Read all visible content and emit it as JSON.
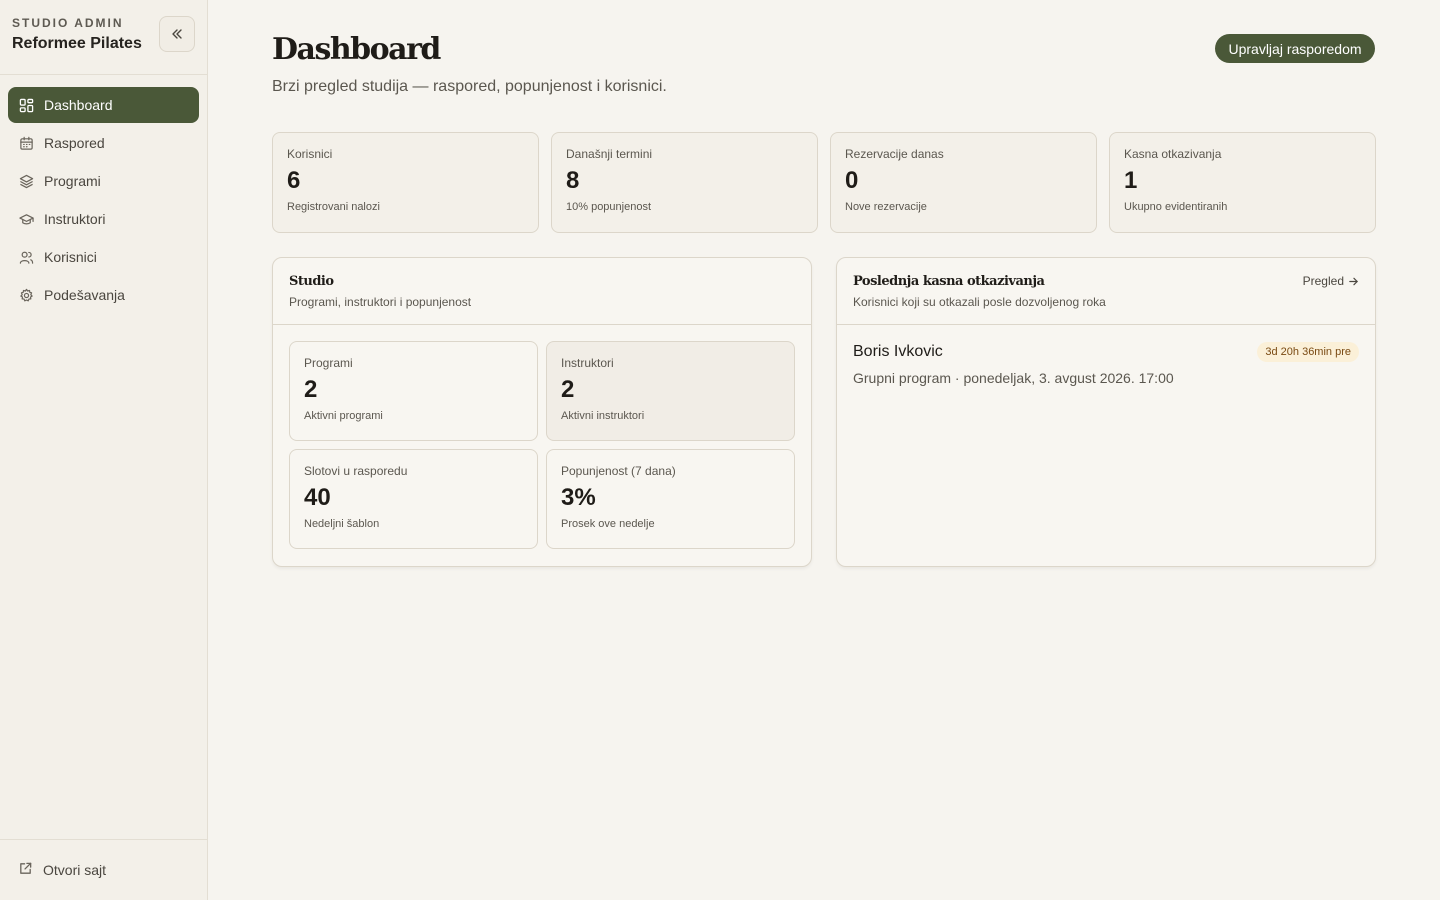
{
  "sidebar": {
    "eyebrow": "STUDIO ADMIN",
    "brand": "Reformee Pilates",
    "items": [
      {
        "label": "Dashboard",
        "icon": "dashboard-icon"
      },
      {
        "label": "Raspored",
        "icon": "calendar-icon"
      },
      {
        "label": "Programi",
        "icon": "layers-icon"
      },
      {
        "label": "Instruktori",
        "icon": "graduation-cap-icon"
      },
      {
        "label": "Korisnici",
        "icon": "users-icon"
      },
      {
        "label": "Podešavanja",
        "icon": "gear-icon"
      }
    ],
    "footer_link": "Otvori sajt"
  },
  "header": {
    "title": "Dashboard",
    "subtitle": "Brzi pregled studija — raspored, popunjenost i korisnici.",
    "action": "Upravljaj rasporedom"
  },
  "stats": [
    {
      "label": "Korisnici",
      "value": "6",
      "hint": "Registrovani nalozi"
    },
    {
      "label": "Današnji termini",
      "value": "8",
      "hint": "10% popunjenost"
    },
    {
      "label": "Rezervacije danas",
      "value": "0",
      "hint": "Nove rezervacije"
    },
    {
      "label": "Kasna otkazivanja",
      "value": "1",
      "hint": "Ukupno evidentiranih"
    }
  ],
  "studio_panel": {
    "title": "Studio",
    "desc": "Programi, instruktori i popunjenost",
    "tiles": [
      {
        "label": "Programi",
        "value": "2",
        "hint": "Aktivni programi"
      },
      {
        "label": "Instruktori",
        "value": "2",
        "hint": "Aktivni instruktori"
      },
      {
        "label": "Slotovi u rasporedu",
        "value": "40",
        "hint": "Nedeljni šablon"
      },
      {
        "label": "Popunjenost (7 dana)",
        "value": "3%",
        "hint": "Prosek ove nedelje"
      }
    ]
  },
  "cancellations_panel": {
    "title": "Poslednja kasna otkazivanja",
    "desc": "Korisnici koji su otkazali posle dozvoljenog roka",
    "link": "Pregled",
    "entries": [
      {
        "name": "Boris Ivkovic",
        "meta": "Grupni program · ponedeljak, 3. avgust 2026. 17:00",
        "badge": "3d 20h 36min pre"
      }
    ]
  },
  "colors": {
    "accent": "#4a5838",
    "background": "#f6f4ef",
    "sidebar": "#f3f0e9",
    "badge_bg": "#fbf0d8",
    "badge_text": "#7a4a12"
  }
}
